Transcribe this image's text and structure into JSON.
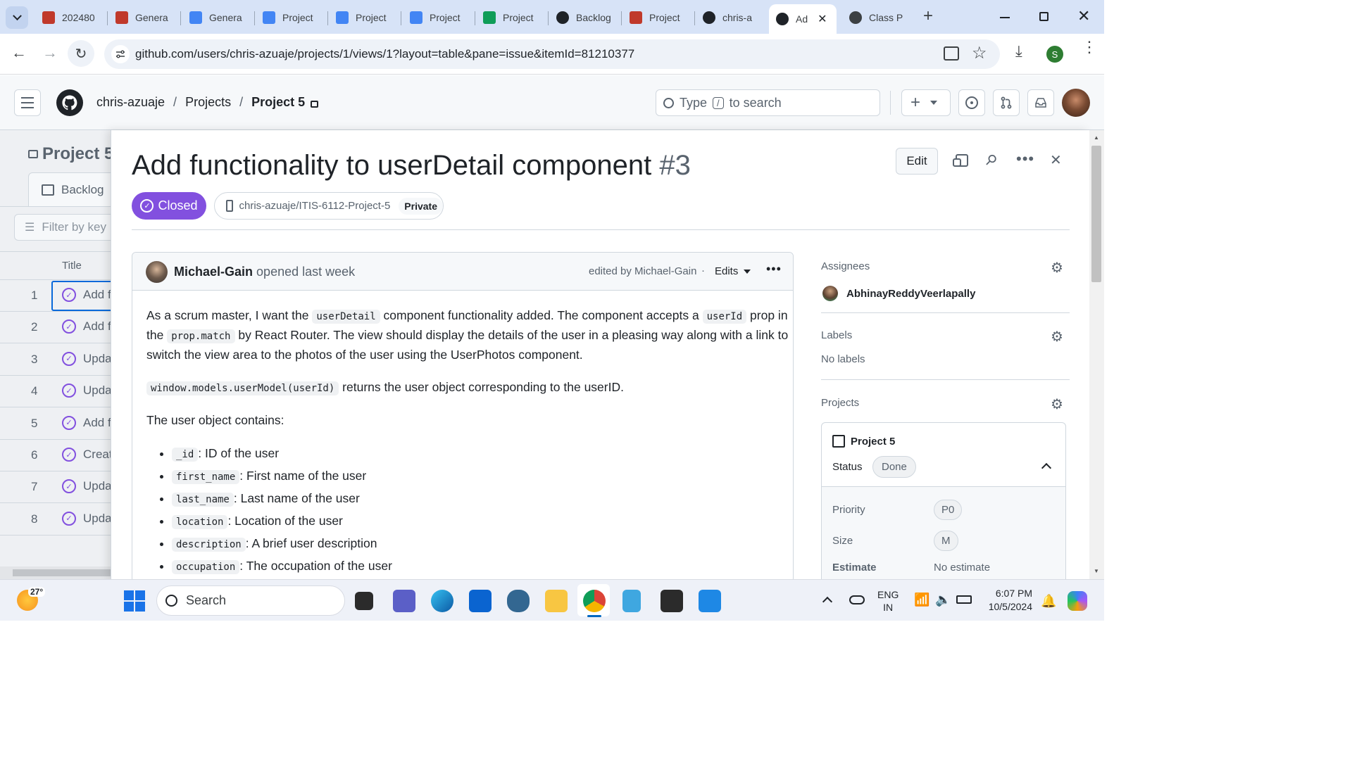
{
  "browser": {
    "tabs": [
      {
        "label": "202480",
        "icon": "redmine-icon"
      },
      {
        "label": "Genera",
        "icon": "redmine-icon"
      },
      {
        "label": "Genera",
        "icon": "docs-icon"
      },
      {
        "label": "Project",
        "icon": "docs-icon"
      },
      {
        "label": "Project",
        "icon": "docs-icon"
      },
      {
        "label": "Project",
        "icon": "docs-icon"
      },
      {
        "label": "Project",
        "icon": "drive-icon"
      },
      {
        "label": "Backlog",
        "icon": "github-icon"
      },
      {
        "label": "Project",
        "icon": "redmine-icon"
      },
      {
        "label": "chris-a",
        "icon": "github-icon"
      },
      {
        "label": "Ad",
        "icon": "github-icon",
        "active": true
      },
      {
        "label": "Class P",
        "icon": "globe-icon"
      }
    ],
    "url": "github.com/users/chris-azuaje/projects/1/views/1?layout=table&pane=issue&itemId=81210377",
    "profile_initial": "S"
  },
  "github_header": {
    "breadcrumb": [
      "chris-azuaje",
      "/",
      "Projects",
      "/",
      "Project 5"
    ],
    "search_prefix": "Type",
    "search_key": "/",
    "search_suffix": "to search",
    "plus_label": "+"
  },
  "project_table": {
    "title": "Project 5",
    "view_tab": "Backlog",
    "filter_placeholder": "Filter by key",
    "column_title": "Title",
    "rows": [
      {
        "num": "1",
        "title": "Add f"
      },
      {
        "num": "2",
        "title": "Add f"
      },
      {
        "num": "3",
        "title": "Upda"
      },
      {
        "num": "4",
        "title": "Upda"
      },
      {
        "num": "5",
        "title": "Add f"
      },
      {
        "num": "6",
        "title": "Creat"
      },
      {
        "num": "7",
        "title": "Upda"
      },
      {
        "num": "8",
        "title": "Upda"
      }
    ]
  },
  "issue": {
    "title": "Add functionality to userDetail component",
    "number": "#3",
    "edit_label": "Edit",
    "state": "Closed",
    "repo": "chris-azuaje/ITIS-6112-Project-5",
    "visibility": "Private",
    "author": "Michael-Gain",
    "opened": "opened last week",
    "edited_by": "edited by Michael-Gain",
    "dot": "·",
    "edits_label": "Edits",
    "body": {
      "p1a": "As a scrum master, I want the",
      "p1code1": "userDetail",
      "p1b": "component functionality added. The component accepts a",
      "p1code2": "userId",
      "p1c": "prop in",
      "p1d": "the",
      "p1code3": "prop.match",
      "p1e": "by React Router. The view should display the details of the user in a pleasing way along with a link to",
      "p1f": "switch the view area to the photos of the user using the UserPhotos component.",
      "p2code": "window.models.userModel(userId)",
      "p2": "returns the user object corresponding to the userID.",
      "p3": "The user object contains:",
      "fields": [
        {
          "code": "_id",
          "desc": ": ID of the user"
        },
        {
          "code": "first_name",
          "desc": ": First name of the user"
        },
        {
          "code": "last_name",
          "desc": ": Last name of the user"
        },
        {
          "code": "location",
          "desc": ": Location of the user"
        },
        {
          "code": "description",
          "desc": ": A brief user description"
        },
        {
          "code": "occupation",
          "desc": ": The occupation of the user"
        }
      ]
    },
    "sidebar": {
      "assignees_label": "Assignees",
      "assignee": "AbhinayReddyVeerlapally",
      "labels_label": "Labels",
      "labels_value": "No labels",
      "projects_label": "Projects",
      "project_name": "Project 5",
      "status_label": "Status",
      "status_value": "Done",
      "priority_label": "Priority",
      "priority_value": "P0",
      "size_label": "Size",
      "size_value": "M",
      "estimate_label": "Estimate",
      "estimate_value": "No estimate"
    }
  },
  "taskbar": {
    "weather_temp": "27°",
    "search_label": "Search",
    "lang_top": "ENG",
    "lang_bottom": "IN",
    "time": "6:07 PM",
    "date": "10/5/2024"
  },
  "colors": {
    "closed_purple": "#8250df",
    "tab_strip": "#d7e3f7",
    "accent_blue": "#0969da"
  }
}
